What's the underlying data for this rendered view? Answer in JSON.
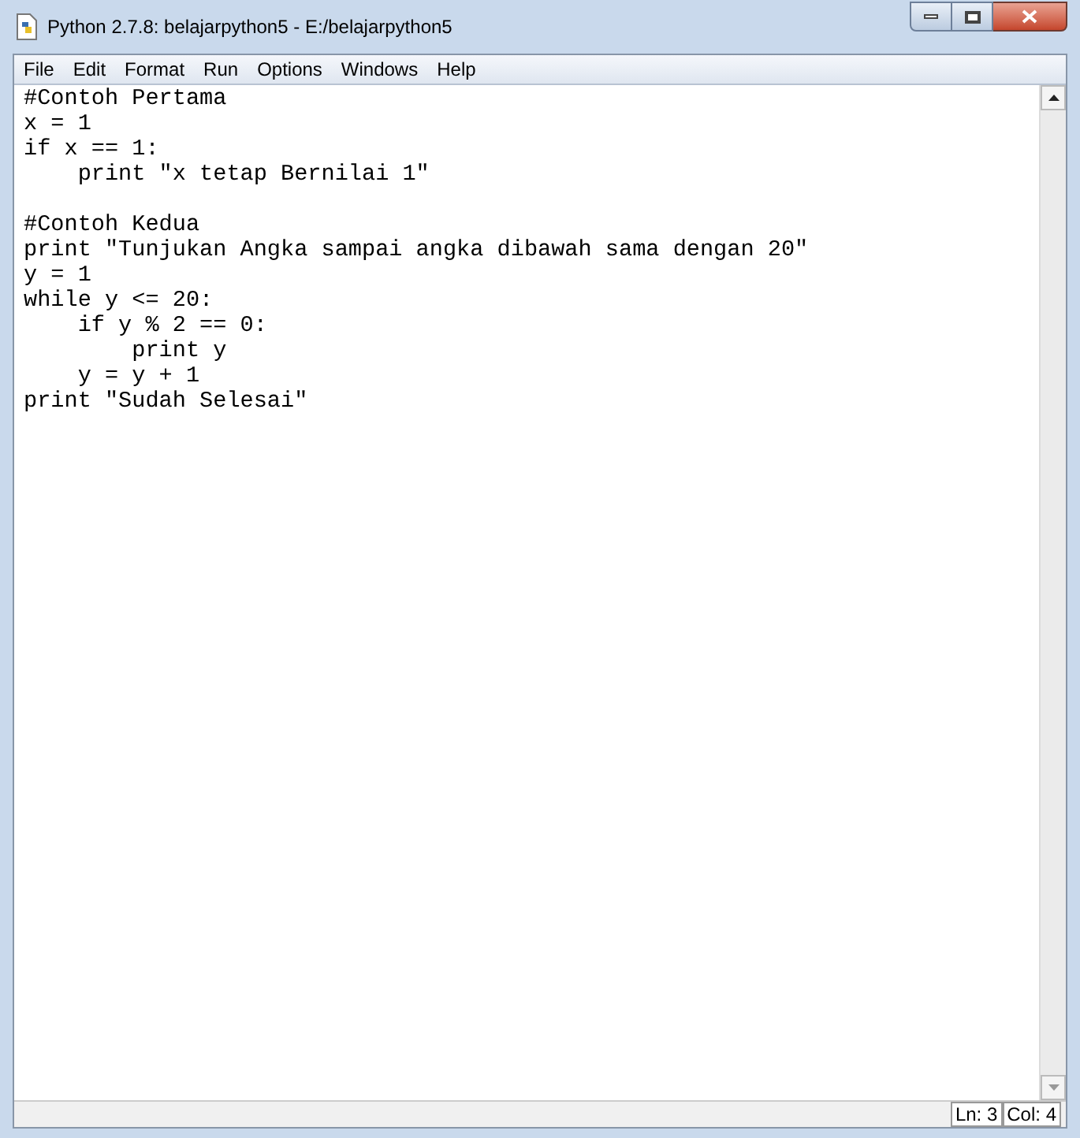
{
  "window": {
    "title": "Python 2.7.8: belajarpython5 - E:/belajarpython5"
  },
  "menu": [
    "File",
    "Edit",
    "Format",
    "Run",
    "Options",
    "Windows",
    "Help"
  ],
  "editor": {
    "blocks": [
      [
        "#Contoh Pertama",
        "x = 1",
        "if x == 1:",
        "    print \"x tetap Bernilai 1\""
      ],
      [
        "#Contoh Kedua",
        "print \"Tunjukan Angka sampai angka dibawah sama dengan 20\"",
        "y = 1",
        "while y <= 20:",
        "    if y % 2 == 0:",
        "        print y",
        "    y = y + 1",
        "print \"Sudah Selesai\""
      ]
    ]
  },
  "status_bar": {
    "line": "Ln: 3",
    "column": "Col: 4"
  }
}
